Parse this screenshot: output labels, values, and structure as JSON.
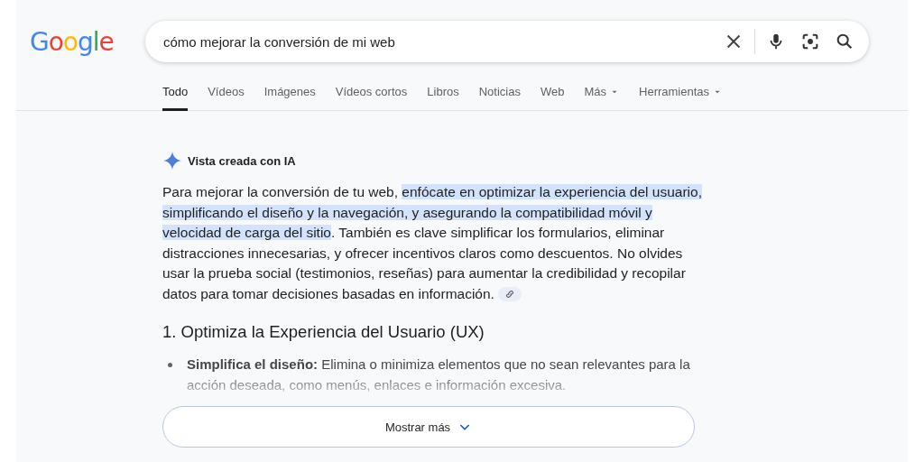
{
  "logo": "Google",
  "search": {
    "value": "cómo mejorar la conversión de mi web"
  },
  "tabs": [
    {
      "label": "Todo",
      "selected": true,
      "has_menu": false
    },
    {
      "label": "Vídeos",
      "selected": false,
      "has_menu": false
    },
    {
      "label": "Imágenes",
      "selected": false,
      "has_menu": false
    },
    {
      "label": "Vídeos cortos",
      "selected": false,
      "has_menu": false
    },
    {
      "label": "Libros",
      "selected": false,
      "has_menu": false
    },
    {
      "label": "Noticias",
      "selected": false,
      "has_menu": false
    },
    {
      "label": "Web",
      "selected": false,
      "has_menu": false
    },
    {
      "label": "Más",
      "selected": false,
      "has_menu": true
    },
    {
      "label": "Herramientas",
      "selected": false,
      "has_menu": true
    }
  ],
  "ai_overview": {
    "title": "Vista creada con IA",
    "paragraph": [
      {
        "text": "Para mejorar la conversión de tu web, ",
        "highlighted": false
      },
      {
        "text": "enfócate en optimizar la experiencia del usuario, simplificando el diseño y la navegación, y asegurando la compatibilidad móvil y velocidad de carga del sitio",
        "highlighted": true
      },
      {
        "text": ". También es clave simplificar los formularios, eliminar distracciones innecesarias, y ofrecer incentivos claros como descuentos. No olvides usar la prueba social (testimonios, reseñas) para aumentar la credibilidad y recopilar datos para tomar decisiones basadas en información.",
        "highlighted": false
      }
    ],
    "heading": "1. Optimiza la Experiencia del Usuario (UX)",
    "bullets": [
      "**Simplifica el diseño:** Elimina o minimiza elementos que no sean relevantes para la acción deseada, como menús, enlaces e información excesiva."
    ],
    "show_more": "Mostrar más"
  }
}
